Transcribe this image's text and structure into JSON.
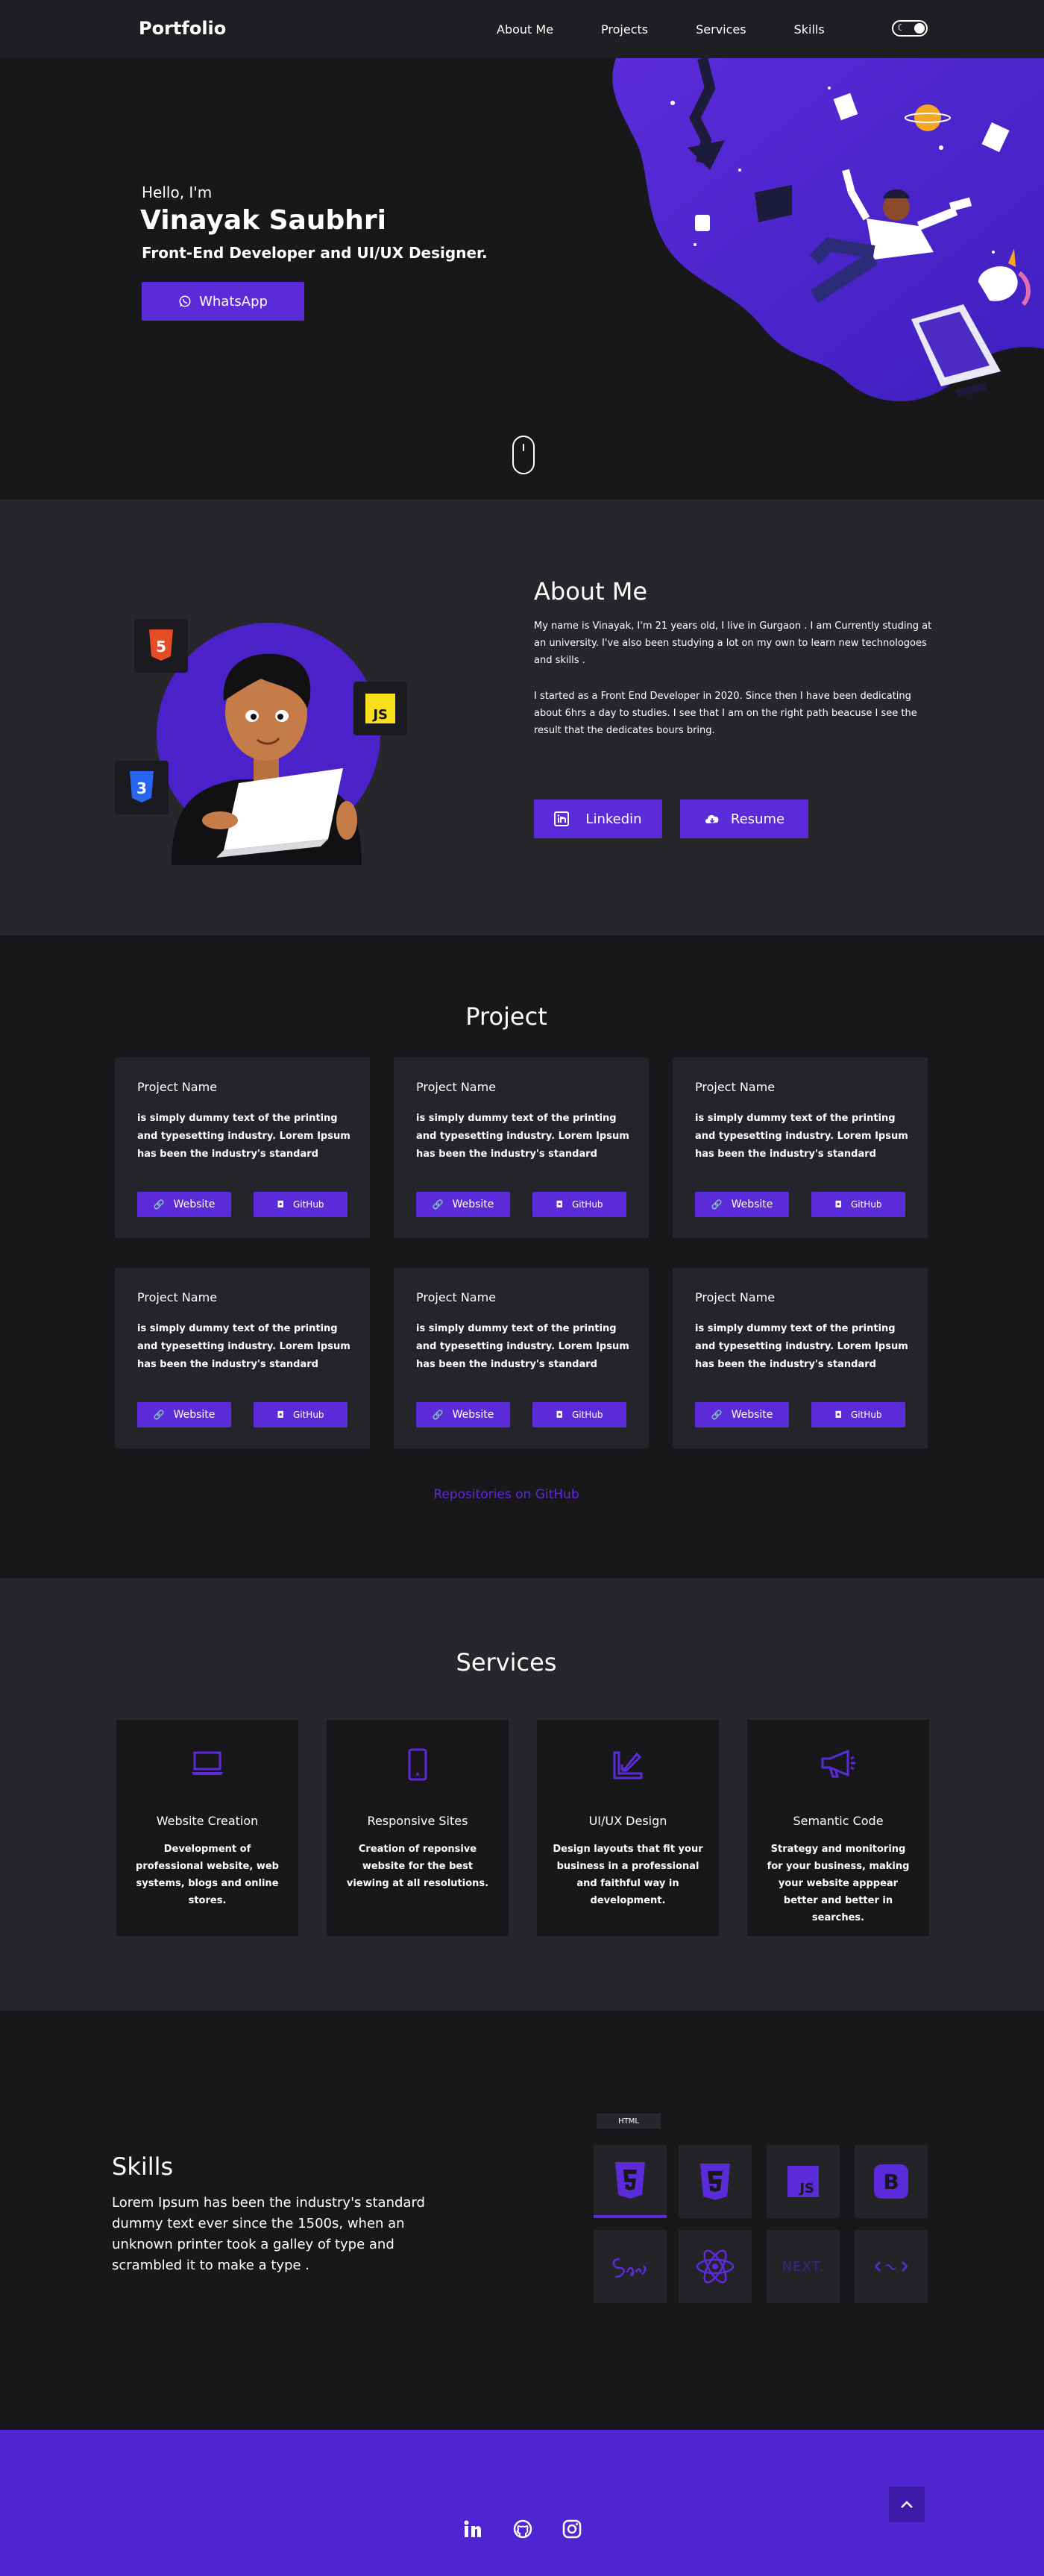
{
  "nav": {
    "brand": "Portfolio",
    "links": [
      "About Me",
      "Projects",
      "Services",
      "Skills"
    ],
    "theme_toggle_icon": "moon-icon"
  },
  "hero": {
    "greeting": "Hello, I'm",
    "name": "Vinayak Saubhri",
    "role": "Front-End Developer and UI/UX Designer.",
    "whatsapp_label": "WhatsApp"
  },
  "about": {
    "title": "About Me",
    "paragraph1": "My name is Vinayak, I'm 21 years old, I live in Gurgaon . I am Currently studing at an university. I've also been studying a lot on my own to learn new technologoes and skills .",
    "paragraph2": "I started as a Front End Developer in 2020. Since then I have been dedicating about 6hrs a day to studies. I see that I am on the right path beacuse I see the result that the dedicates bours bring.",
    "linkedin_label": "Linkedin",
    "resume_label": "Resume",
    "badges": [
      "HTML5",
      "JS",
      "CSS3"
    ]
  },
  "projects": {
    "title": "Project",
    "items": [
      {
        "name": "Project Name",
        "description": "is simply dummy text of the printing and typesetting industry. Lorem Ipsum has been the industry's standard",
        "website_label": "Website",
        "github_label": "GitHub"
      },
      {
        "name": "Project Name",
        "description": "is simply dummy text of the printing and typesetting industry. Lorem Ipsum has been the industry's standard",
        "website_label": "Website",
        "github_label": "GitHub"
      },
      {
        "name": "Project Name",
        "description": "is simply dummy text of the printing and typesetting industry. Lorem Ipsum has been the industry's standard",
        "website_label": "Website",
        "github_label": "GitHub"
      },
      {
        "name": "Project Name",
        "description": "is simply dummy text of the printing and typesetting industry. Lorem Ipsum has been the industry's standard",
        "website_label": "Website",
        "github_label": "GitHub"
      },
      {
        "name": "Project Name",
        "description": "is simply dummy text of the printing and typesetting industry. Lorem Ipsum has been the industry's standard",
        "website_label": "Website",
        "github_label": "GitHub"
      },
      {
        "name": "Project Name",
        "description": "is simply dummy text of the printing and typesetting industry. Lorem Ipsum has been the industry's standard",
        "website_label": "Website",
        "github_label": "GitHub"
      }
    ],
    "repos_link": "Repositories on GitHub"
  },
  "services": {
    "title": "Services",
    "items": [
      {
        "title": "Website Creation",
        "description": "Development of professional website, web systems, blogs and online stores.",
        "icon": "laptop-icon"
      },
      {
        "title": "Responsive Sites",
        "description": "Creation of reponsive website for the best viewing at all resolutions.",
        "icon": "smartphone-icon"
      },
      {
        "title": "UI/UX Design",
        "description": "Design layouts that fit your business in a professional and faithful way in development.",
        "icon": "design-tools-icon"
      },
      {
        "title": "Semantic Code",
        "description": "Strategy and monitoring for your business, making your website apppear better and better in searches.",
        "icon": "megaphone-icon"
      }
    ]
  },
  "skills": {
    "title": "Skills",
    "description": "Lorem Ipsum has been the industry's standard dummy text ever since the 1500s, when an unknown printer took a galley of type and scrambled it to make a type .",
    "tooltip": "HTML",
    "tiles": [
      "html5-icon",
      "css3-icon",
      "javascript-icon",
      "bootstrap-icon",
      "sass-icon",
      "react-icon",
      "nextjs-icon",
      "tailwind-icon"
    ],
    "next_label": "NEXT.",
    "accent": "#5b2bd9"
  },
  "footer": {
    "icons": [
      "linkedin-icon",
      "github-icon",
      "instagram-icon"
    ],
    "back_to_top_icon": "chevron-up-icon",
    "background": "#5124d2"
  }
}
